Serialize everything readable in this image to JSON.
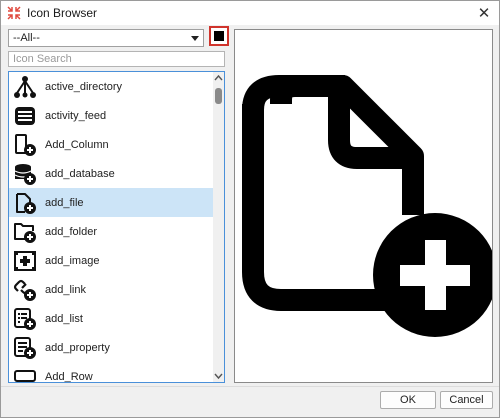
{
  "window": {
    "title": "Icon Browser"
  },
  "toolbar": {
    "category_value": "--All--",
    "color_swatch": "#000000"
  },
  "search": {
    "placeholder": "Icon Search",
    "value": ""
  },
  "icons": [
    {
      "label": "active_directory",
      "icon": "active-directory-icon"
    },
    {
      "label": "activity_feed",
      "icon": "activity-feed-icon"
    },
    {
      "label": "Add_Column",
      "icon": "add-column-icon"
    },
    {
      "label": "add_database",
      "icon": "add-database-icon"
    },
    {
      "label": "add_file",
      "icon": "add-file-icon",
      "selected": true
    },
    {
      "label": "add_folder",
      "icon": "add-folder-icon"
    },
    {
      "label": "add_image",
      "icon": "add-image-icon"
    },
    {
      "label": "add_link",
      "icon": "add-link-icon"
    },
    {
      "label": "add_list",
      "icon": "add-list-icon"
    },
    {
      "label": "add_property",
      "icon": "add-property-icon"
    },
    {
      "label": "Add_Row",
      "icon": "add-row-icon"
    }
  ],
  "preview": {
    "icon": "add-file-icon"
  },
  "buttons": {
    "ok": "OK",
    "cancel": "Cancel"
  },
  "colors": {
    "selection": "#cce4f7",
    "focus_border": "#4a90d9",
    "highlight_border": "#d0342c"
  }
}
